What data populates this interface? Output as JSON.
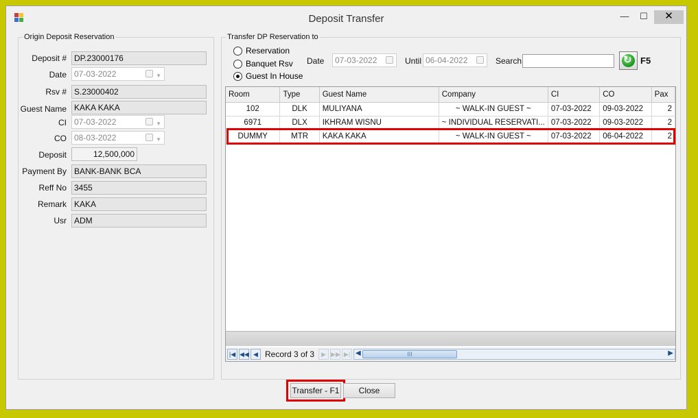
{
  "window": {
    "title": "Deposit Transfer",
    "controls": {
      "minimize": "—",
      "maximize": "☐",
      "close": "✕"
    }
  },
  "origin": {
    "legend": "Origin Deposit Reservation",
    "fields": {
      "deposit_no": {
        "label": "Deposit #",
        "value": "DP.23000176"
      },
      "date": {
        "label": "Date",
        "value": "07-03-2022"
      },
      "rsv_no": {
        "label": "Rsv #",
        "value": "S.23000402"
      },
      "guest_name": {
        "label": "Guest Name",
        "value": "KAKA KAKA"
      },
      "ci": {
        "label": "CI",
        "value": "07-03-2022"
      },
      "co": {
        "label": "CO",
        "value": "08-03-2022"
      },
      "deposit": {
        "label": "Deposit",
        "value": "12,500,000"
      },
      "payment_by": {
        "label": "Payment By",
        "value": "BANK-BANK BCA"
      },
      "reff_no": {
        "label": "Reff No",
        "value": "3455"
      },
      "remark": {
        "label": "Remark",
        "value": "KAKA"
      },
      "usr": {
        "label": "Usr",
        "value": "ADM"
      }
    }
  },
  "transfer": {
    "legend": "Transfer DP Reservation to",
    "radios": [
      {
        "label": "Reservation",
        "selected": false
      },
      {
        "label": "Banquet Rsv",
        "selected": false
      },
      {
        "label": "Guest In House",
        "selected": true
      }
    ],
    "filters": {
      "date_label": "Date",
      "date_value": "07-03-2022",
      "until_label": "Until",
      "until_value": "06-04-2022",
      "search_label": "Search",
      "search_value": "",
      "refresh_key": "F5"
    },
    "grid": {
      "columns": [
        "Room",
        "Type",
        "Guest Name",
        "Company",
        "CI",
        "CO",
        "Pax"
      ],
      "rows": [
        [
          "102",
          "DLK",
          "MULIYANA",
          "~ WALK-IN GUEST ~",
          "07-03-2022",
          "09-03-2022",
          "2"
        ],
        [
          "6971",
          "DLX",
          "IKHRAM WISNU",
          "~ INDIVIDUAL RESERVATI...",
          "07-03-2022",
          "09-03-2022",
          "2"
        ],
        [
          "DUMMY",
          "MTR",
          "KAKA KAKA",
          "~ WALK-IN GUEST ~",
          "07-03-2022",
          "06-04-2022",
          "2"
        ]
      ],
      "selected_row": 3,
      "navigator": {
        "record_text": "Record 3 of 3",
        "scroll_grip": "III"
      }
    }
  },
  "buttons": {
    "transfer": "Transfer - F1",
    "close": "Close"
  },
  "colors": {
    "highlight": "#e00000",
    "background": "#c8c800"
  }
}
